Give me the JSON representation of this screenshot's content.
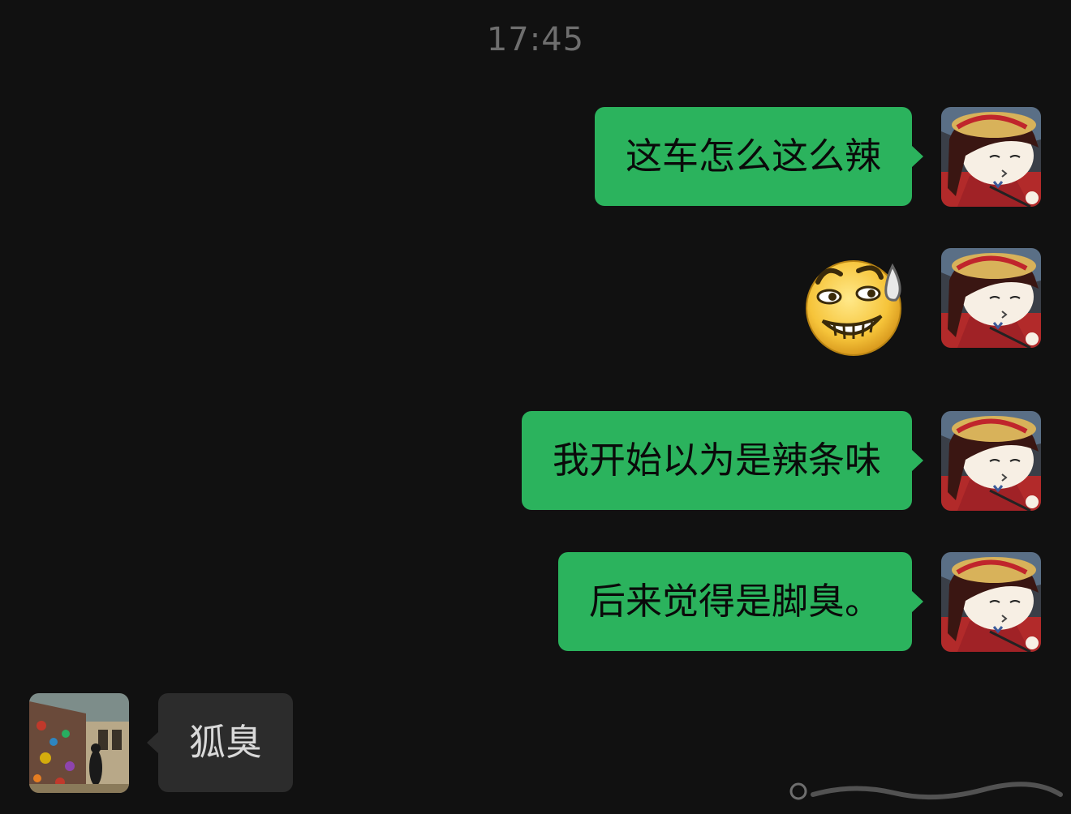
{
  "time": "17:45",
  "messages": [
    {
      "side": "out",
      "type": "text",
      "text": "这车怎么这么辣"
    },
    {
      "side": "out",
      "type": "sticker",
      "sticker": "grimace-sweat-emoji-icon"
    },
    {
      "side": "out",
      "type": "text",
      "text": "我开始以为是辣条味"
    },
    {
      "side": "out",
      "type": "text",
      "text": "后来觉得是脚臭。"
    },
    {
      "side": "in",
      "type": "text",
      "text": "狐臭"
    }
  ],
  "colors": {
    "background": "#111111",
    "outgoing_bubble": "#2bb35d",
    "incoming_bubble": "#2c2c2c"
  }
}
